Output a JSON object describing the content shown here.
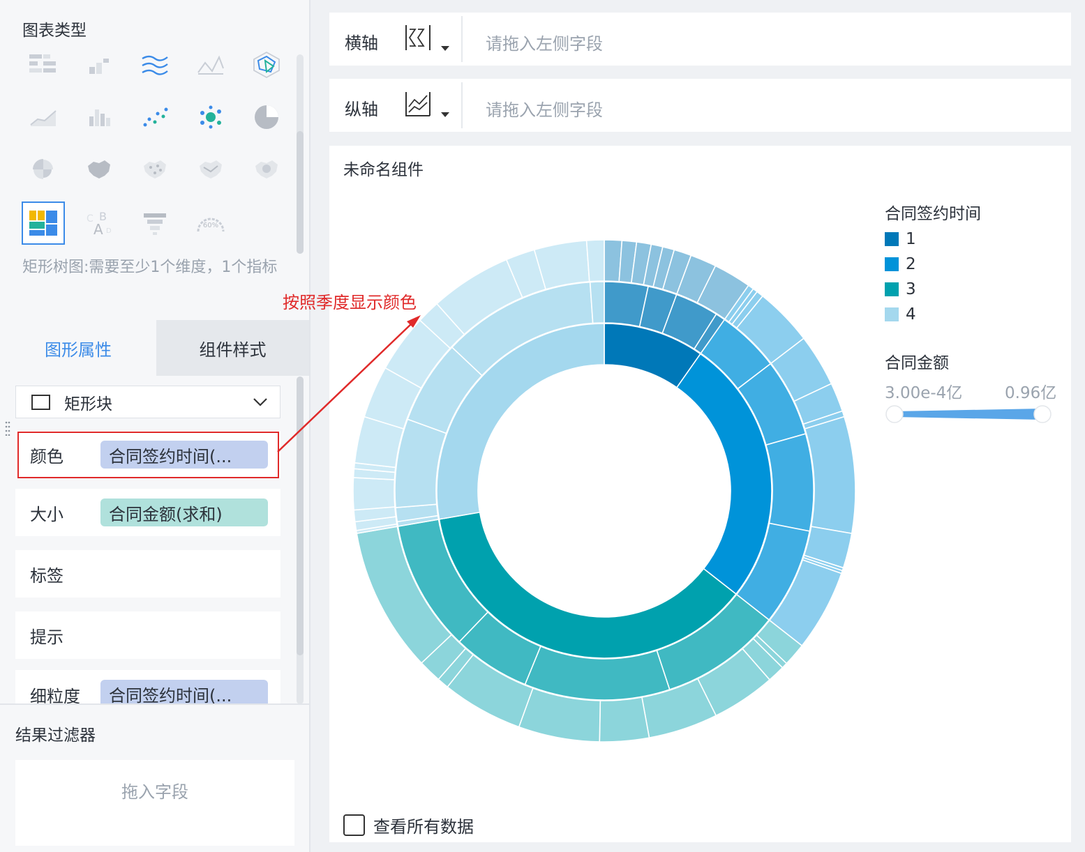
{
  "chart_type_panel": {
    "title": "图表类型",
    "hint": "矩形树图:需要至少1个维度，1个指标",
    "icons": [
      "grouped-table-icon",
      "bar-chart-icon",
      "stream-chart-icon",
      "line-area-icon",
      "radar-chart-icon",
      "area-line-icon",
      "combo-bar-icon",
      "scatter-icon",
      "bubble-icon",
      "pie-chart-icon",
      "rose-chart-icon",
      "region-map-icon",
      "point-map-icon",
      "flow-map-icon",
      "heat-map-icon",
      "treemap-icon",
      "word-cloud-icon",
      "funnel-icon",
      "gauge-icon"
    ],
    "gauge_text": "60%"
  },
  "tabs": {
    "graph": "图形属性",
    "style": "组件样式"
  },
  "shape_select": {
    "value": "矩形块"
  },
  "properties": {
    "color": {
      "label": "颜色",
      "field": "合同签约时间(..."
    },
    "size": {
      "label": "大小",
      "field": "合同金额(求和)"
    },
    "label": {
      "label": "标签"
    },
    "tooltip": {
      "label": "提示"
    },
    "granularity": {
      "label": "细粒度",
      "field": "合同签约时间(..."
    }
  },
  "result_filter": {
    "title": "结果过滤器",
    "placeholder": "拖入字段"
  },
  "x_axis": {
    "label": "横轴",
    "placeholder": "请拖入左侧字段"
  },
  "y_axis": {
    "label": "纵轴",
    "placeholder": "请拖入左侧字段"
  },
  "component": {
    "title": "未命名组件"
  },
  "legend": {
    "color_title": "合同签约时间",
    "items": [
      {
        "label": "1",
        "color": "#0078b8"
      },
      {
        "label": "2",
        "color": "#0093d9"
      },
      {
        "label": "3",
        "color": "#00a1ae"
      },
      {
        "label": "4",
        "color": "#a4d8ee"
      }
    ],
    "size_title": "合同金额",
    "size_min": "3.00e-4亿",
    "size_max": "0.96亿"
  },
  "see_all_data": "查看所有数据",
  "annotation": "按照季度显示颜色",
  "chart_data": {
    "type": "sunburst",
    "title": "未命名组件",
    "color_field": "合同签约时间",
    "size_field": "合同金额",
    "quarters": [
      {
        "name": "1",
        "value": 0.26,
        "color": "#0078b8",
        "level2": [
          0.09,
          0.06,
          0.09,
          0.02
        ],
        "level3": [
          0.03,
          0.025,
          0.025,
          0.02,
          0.02,
          0.03,
          0.045,
          0.065
        ]
      },
      {
        "name": "2",
        "value": 0.69,
        "color": "#0093d9",
        "level2": [
          0.13,
          0.16,
          0.2,
          0.2
        ],
        "level3": [
          0.01,
          0.008,
          0.012,
          0.1,
          0.09,
          0.05,
          0.01,
          0.2,
          0.06,
          0.005,
          0.005,
          0.14
        ]
      },
      {
        "name": "3",
        "value": 0.98,
        "color": "#00a1ae",
        "level2": [
          0.25,
          0.3,
          0.16,
          0.27
        ],
        "level3": [
          0.04,
          0.01,
          0.03,
          0.11,
          0.12,
          0.085,
          0.14,
          0.14,
          0.02,
          0.04,
          0.25
        ]
      },
      {
        "name": "4",
        "value": 0.74,
        "color": "#a4d8ee",
        "level2": [
          0.01,
          0.03,
          0.19,
          0.18,
          0.33,
          0.03
        ],
        "level3": [
          0.005,
          0.015,
          0.02,
          0.055,
          0.015,
          0.01,
          0.08,
          0.09,
          0.1,
          0.04,
          0.14,
          0.05,
          0.09,
          0.03
        ]
      }
    ]
  }
}
